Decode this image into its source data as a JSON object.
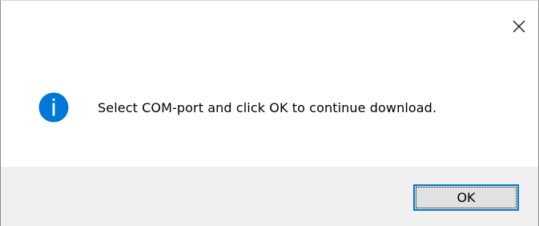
{
  "dialog": {
    "title": "",
    "message": "Select COM-port and click OK to continue download.",
    "icon": "info-icon",
    "ok_label": "OK",
    "close_icon": "close-icon"
  },
  "colors": {
    "info_icon_fill": "#0078d7",
    "ok_border": "#0078d7",
    "footer_bg": "#f0f0f0",
    "button_bg": "#e1e1e1"
  }
}
